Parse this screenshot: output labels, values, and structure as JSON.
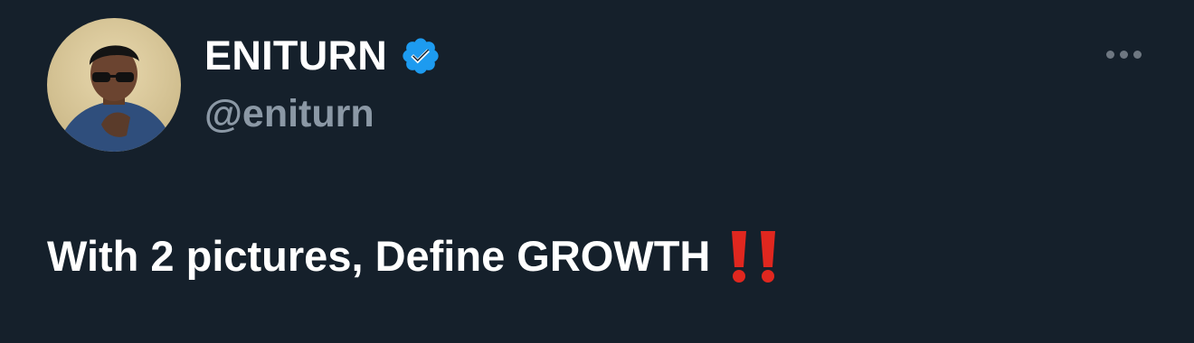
{
  "tweet": {
    "author": {
      "display_name": "ENITURN",
      "handle": "@eniturn",
      "verified": true,
      "avatar_icon": "profile-photo-man-sunglasses"
    },
    "text": "With 2 pictures, Define GROWTH",
    "text_emoji": "double-exclamation-icon",
    "more_icon": "more-options-icon"
  },
  "colors": {
    "background": "#15202b",
    "display_name": "#ffffff",
    "handle": "#8b98a5",
    "verified_badge": "#1d9bf0",
    "emoji": "#e0271f"
  }
}
